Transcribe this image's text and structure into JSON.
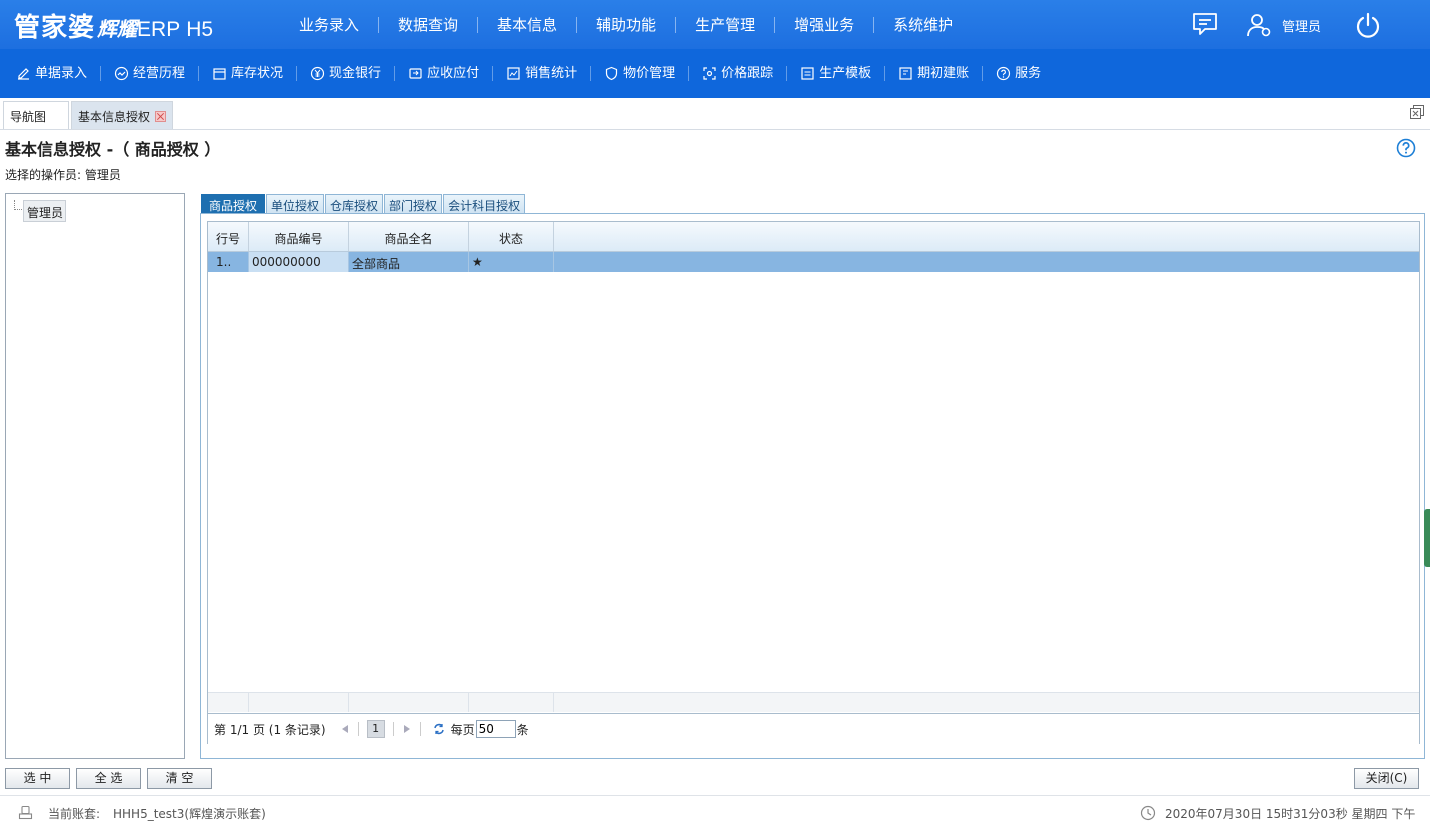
{
  "app": {
    "logo_part1": "管家婆",
    "logo_part2": "辉耀",
    "logo_part3": "ERP",
    "logo_part4": "H5"
  },
  "main_nav": [
    "业务录入",
    "数据查询",
    "基本信息",
    "辅助功能",
    "生产管理",
    "增强业务",
    "系统维护"
  ],
  "user": {
    "name": "管理员"
  },
  "toolbar": [
    {
      "label": "单据录入",
      "icon": "edit-icon"
    },
    {
      "label": "经营历程",
      "icon": "trend-icon"
    },
    {
      "label": "库存状况",
      "icon": "inventory-icon"
    },
    {
      "label": "现金银行",
      "icon": "yuan-icon"
    },
    {
      "label": "应收应付",
      "icon": "ledger-icon"
    },
    {
      "label": "销售统计",
      "icon": "stats-icon"
    },
    {
      "label": "物价管理",
      "icon": "shield-icon"
    },
    {
      "label": "价格跟踪",
      "icon": "target-icon"
    },
    {
      "label": "生产模板",
      "icon": "template-icon"
    },
    {
      "label": "期初建账",
      "icon": "book-icon"
    },
    {
      "label": "服务",
      "icon": "help-circle-icon"
    }
  ],
  "page_tabs": {
    "nav": "导航图",
    "active": "基本信息授权"
  },
  "page": {
    "title": "基本信息授权 -（ 商品授权 ）",
    "operator_label": "选择的操作员: 管理员"
  },
  "tree": {
    "node": "管理员"
  },
  "auth_tabs": [
    "商品授权",
    "单位授权",
    "仓库授权",
    "部门授权",
    "会计科目授权"
  ],
  "grid": {
    "columns": [
      "行号",
      "商品编号",
      "商品全名",
      "状态"
    ],
    "rows": [
      {
        "row_no": "1..",
        "code": "000000000",
        "name": "全部商品",
        "status": "★"
      }
    ]
  },
  "pager": {
    "info": "第 1/1 页 (1 条记录)",
    "current_page": "1",
    "per_page_prefix": "每页",
    "per_page_value": "50",
    "per_page_suffix": "条"
  },
  "buttons": {
    "select": "选 中",
    "select_all": "全 选",
    "clear": "清 空",
    "close": "关闭(C)"
  },
  "status": {
    "account_label": "当前账套:",
    "account_value": "HHH5_test3(辉煌演示账套)",
    "datetime": "2020年07月30日 15时31分03秒 星期四 下午"
  },
  "colors": {
    "topbar": "#1d6fe0",
    "subbar": "#0f67dc",
    "selected_row": "#87b5e1",
    "active_tab": "#1e6fb0"
  }
}
